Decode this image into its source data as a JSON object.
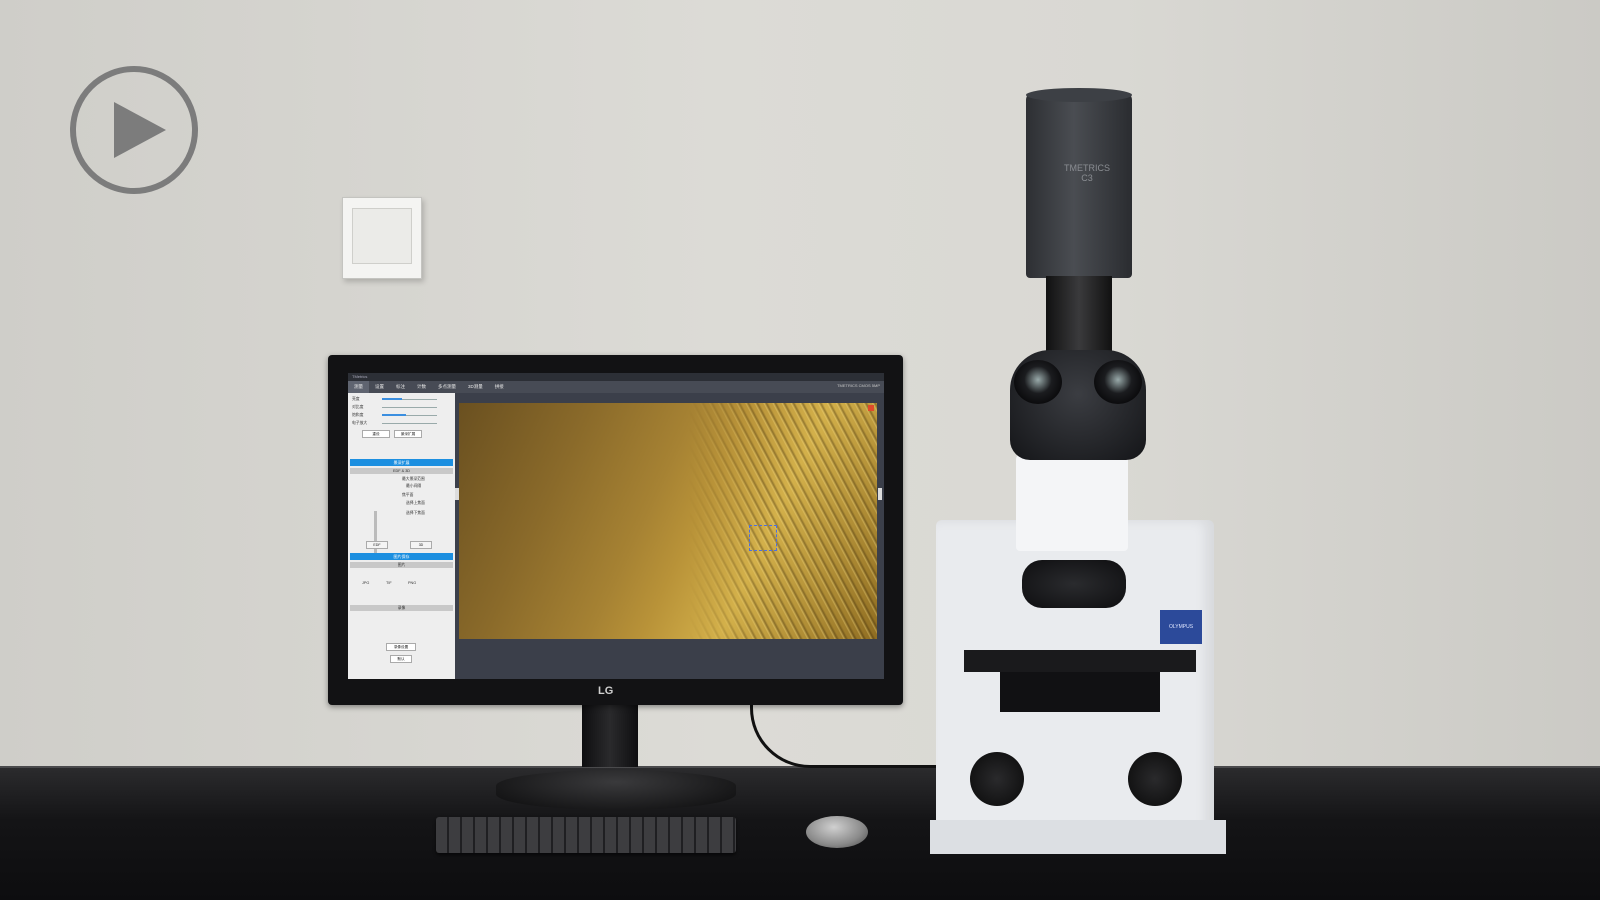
{
  "player": {
    "play_icon": "play-icon"
  },
  "monitor": {
    "brand": "LG",
    "app": {
      "window_title": "TMetrics",
      "toolbar_items": [
        "测量",
        "设置",
        "标注",
        "计数",
        "多点测量",
        "3D测量",
        "拼接"
      ],
      "status_text": "TMETRICS CMOS 5MP",
      "panel": {
        "rows": [
          "亮度",
          "对比度",
          "饱和度",
          "电子放大"
        ],
        "buttons": [
          "重设",
          "景深扩展"
        ],
        "section_edf": "景深扩展",
        "subsection_edf": "EDF & 3D",
        "edf_labels": [
          "最大景深范围",
          "最小间隔",
          "焦平面",
          "选择上焦面",
          "选择下焦面"
        ],
        "edf_button": "EDF",
        "td_button": "3D",
        "section_save": "图片保存",
        "subsection_image": "图片",
        "format_options": [
          "JPG",
          "TIF",
          "PNG"
        ],
        "subsection_video": "录像",
        "video_button": "录像设置",
        "reset_label": "默认"
      }
    }
  },
  "microscope": {
    "camera_label_line1": "TMETRICS",
    "camera_label_line2": "C3",
    "brand_badge": "OLYMPUS"
  },
  "colors": {
    "accent": "#1c8fe0",
    "wall": "#d7d6d1",
    "desk": "#141416",
    "specimen": "#b89238"
  }
}
